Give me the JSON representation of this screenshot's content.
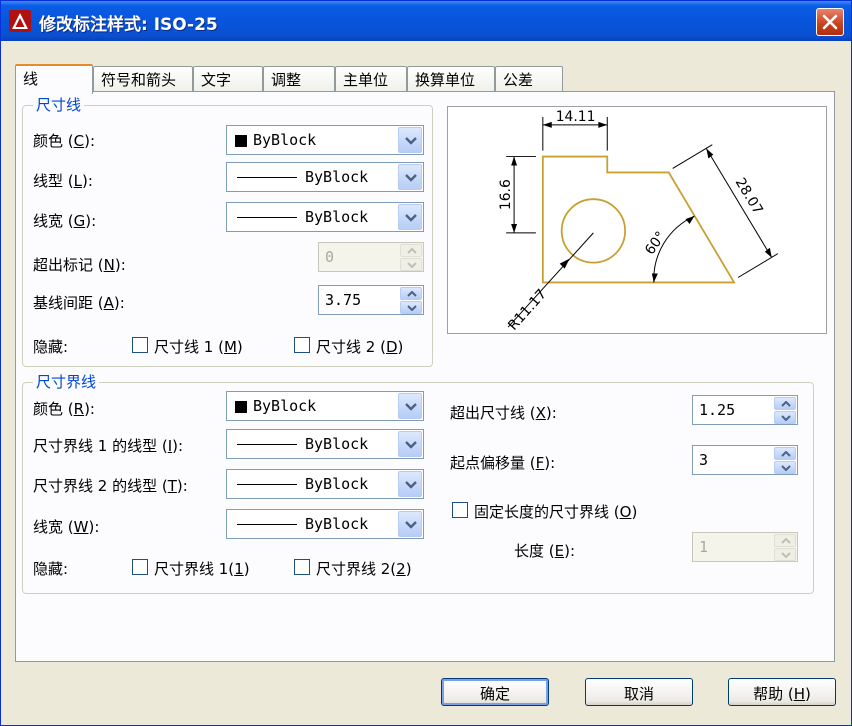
{
  "window": {
    "title": "修改标注样式: ISO-25"
  },
  "tabs": [
    "线",
    "符号和箭头",
    "文字",
    "调整",
    "主单位",
    "换算单位",
    "公差"
  ],
  "dim_lines": {
    "group_title": "尺寸线",
    "color_label": "颜色 (",
    "color_key": "C",
    "color_label_end": "):",
    "color_value": "ByBlock",
    "linetype_label": "线型 (",
    "linetype_key": "L",
    "linetype_label_end": "):",
    "linetype_value": "ByBlock",
    "lineweight_label": "线宽 (",
    "lineweight_key": "G",
    "lineweight_label_end": "):",
    "lineweight_value": "ByBlock",
    "extend_label": "超出标记 (",
    "extend_key": "N",
    "extend_label_end": "):",
    "extend_value": "0",
    "baseline_label": "基线间距 (",
    "baseline_key": "A",
    "baseline_label_end": "):",
    "baseline_value": "3.75",
    "suppress_label": "隐藏:",
    "suppress1_label": "尺寸线 1 (",
    "suppress1_key": "M",
    "suppress1_end": ")",
    "suppress2_label": "尺寸线 2 (",
    "suppress2_key": "D",
    "suppress2_end": ")"
  },
  "ext_lines": {
    "group_title": "尺寸界线",
    "color_label": "颜色 (",
    "color_key": "R",
    "color_label_end": "):",
    "color_value": "ByBlock",
    "lt1_label": "尺寸界线 1 的线型 (",
    "lt1_key": "I",
    "lt1_label_end": "):",
    "lt1_value": "ByBlock",
    "lt2_label": "尺寸界线 2 的线型 (",
    "lt2_key": "T",
    "lt2_label_end": "):",
    "lt2_value": "ByBlock",
    "lw_label": "线宽 (",
    "lw_key": "W",
    "lw_label_end": "):",
    "lw_value": "ByBlock",
    "suppress_label": "隐藏:",
    "suppress1_label": "尺寸界线 1(",
    "suppress1_key": "1",
    "suppress1_end": ")",
    "suppress2_label": "尺寸界线 2(",
    "suppress2_key": "2",
    "suppress2_end": ")",
    "beyond_label": "超出尺寸线 (",
    "beyond_key": "X",
    "beyond_label_end": "):",
    "beyond_value": "1.25",
    "offset_label": "起点偏移量 (",
    "offset_key": "F",
    "offset_label_end": "):",
    "offset_value": "3",
    "fixed_label": "固定长度的尺寸界线 (",
    "fixed_key": "O",
    "fixed_end": ")",
    "length_label": "长度 (",
    "length_key": "E",
    "length_label_end": "):",
    "length_value": "1"
  },
  "preview": {
    "dim_top": "14.11",
    "dim_left": "16.6",
    "dim_right": "28.07",
    "dim_angle": "60°",
    "dim_radius": "R11.17"
  },
  "buttons": {
    "ok": "确定",
    "cancel": "取消",
    "help": "帮助 (",
    "help_key": "H",
    "help_end": ")"
  }
}
